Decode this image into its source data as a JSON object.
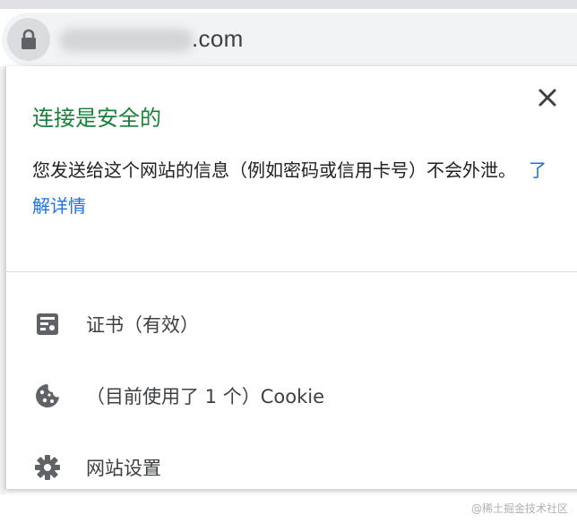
{
  "address_bar": {
    "url_suffix": ".com"
  },
  "popup": {
    "title": "连接是安全的",
    "info_text": "您发送给这个网站的信息（例如密码或信用卡号）不会外泄。",
    "learn_more": "了解详情",
    "close_icon": "close-icon",
    "items": [
      {
        "icon": "certificate-icon",
        "label": "证书（有效）"
      },
      {
        "icon": "cookie-icon",
        "label": "（目前使用了 1 个）Cookie"
      },
      {
        "icon": "gear-icon",
        "label": "网站设置"
      }
    ]
  },
  "colors": {
    "title_green": "#188038",
    "link_blue": "#1a73e8"
  },
  "watermark": "@稀土掘金技术社区"
}
